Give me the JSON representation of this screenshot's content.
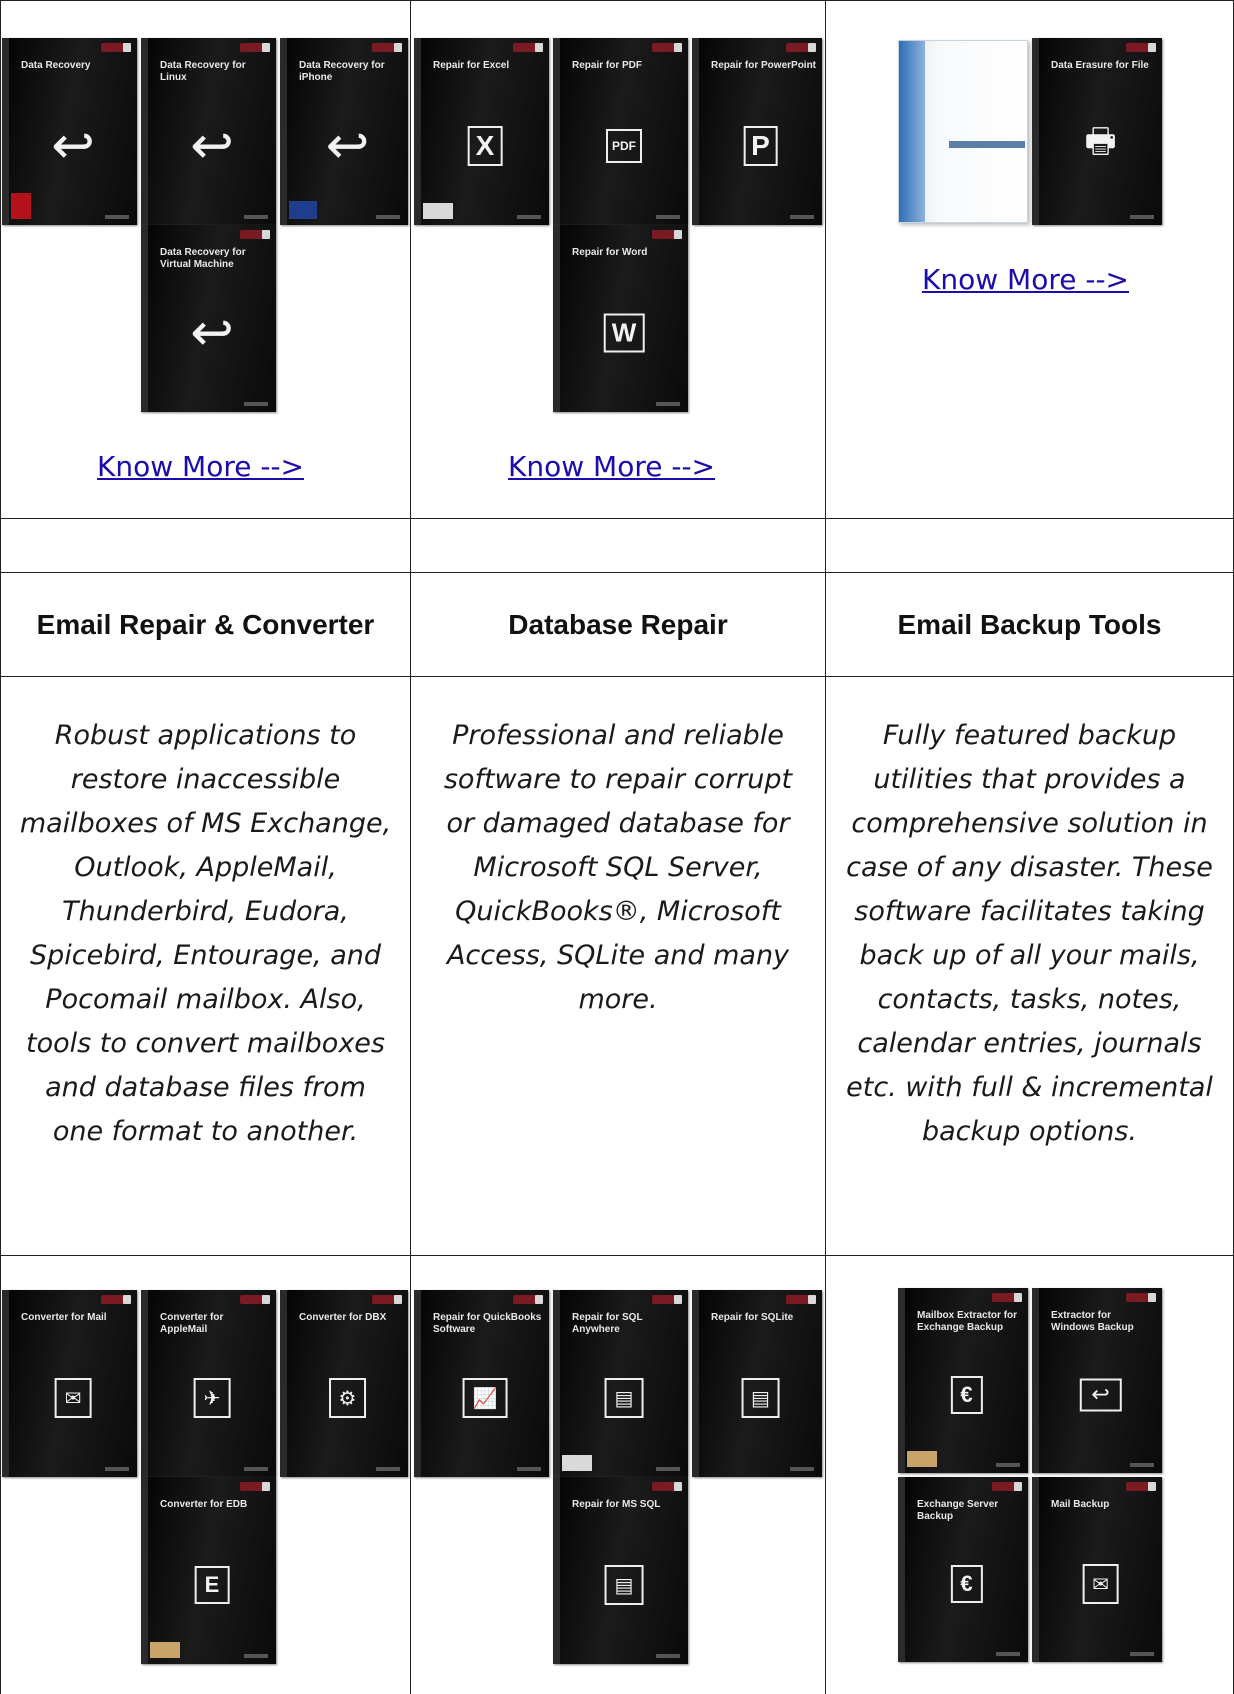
{
  "links": {
    "know_more_1": "Know More -->",
    "know_more_2": "Know More -->",
    "know_more_3": "Know More -->"
  },
  "products_row1": {
    "col1": [
      "Data Recovery",
      "Data Recovery for Linux",
      "Data Recovery for iPhone",
      "Data Recovery for Virtual Machine"
    ],
    "col2": [
      "Repair for Excel",
      "Repair for PDF",
      "Repair for PowerPoint",
      "Repair for Word"
    ],
    "col3": [
      "Data Erasure for File"
    ]
  },
  "headings": {
    "email_repair": "Email Repair & Converter",
    "database_repair": "Database Repair",
    "email_backup": "Email Backup Tools"
  },
  "descriptions": {
    "email_repair": "Robust applications to restore inaccessible mailboxes of MS Exchange, Outlook, AppleMail, Thunderbird, Eudora, Spicebird, Entourage, and Pocomail mailbox. Also, tools to convert mailboxes and database files from one format to another.",
    "database_repair": "Professional and reliable software to repair corrupt or damaged database for Microsoft SQL Server, QuickBooks®, Microsoft Access, SQLite and many more.",
    "email_backup": "Fully featured backup utilities that provides a comprehensive solution in case of any disaster. These software facilitates taking back up of all your mails, contacts, tasks, notes, calendar entries, journals etc. with full & incremental backup options."
  },
  "products_row2": {
    "col1": [
      "Converter for Mail",
      "Converter for AppleMail",
      "Converter for DBX",
      "Converter for EDB"
    ],
    "col2": [
      "Repair for QuickBooks Software",
      "Repair for SQL Anywhere",
      "Repair for SQLite",
      "Repair for MS SQL"
    ],
    "col3": [
      "Mailbox Extractor for Exchange Backup",
      "Extractor for Windows Backup",
      "Exchange Server Backup",
      "Mail Backup"
    ]
  }
}
